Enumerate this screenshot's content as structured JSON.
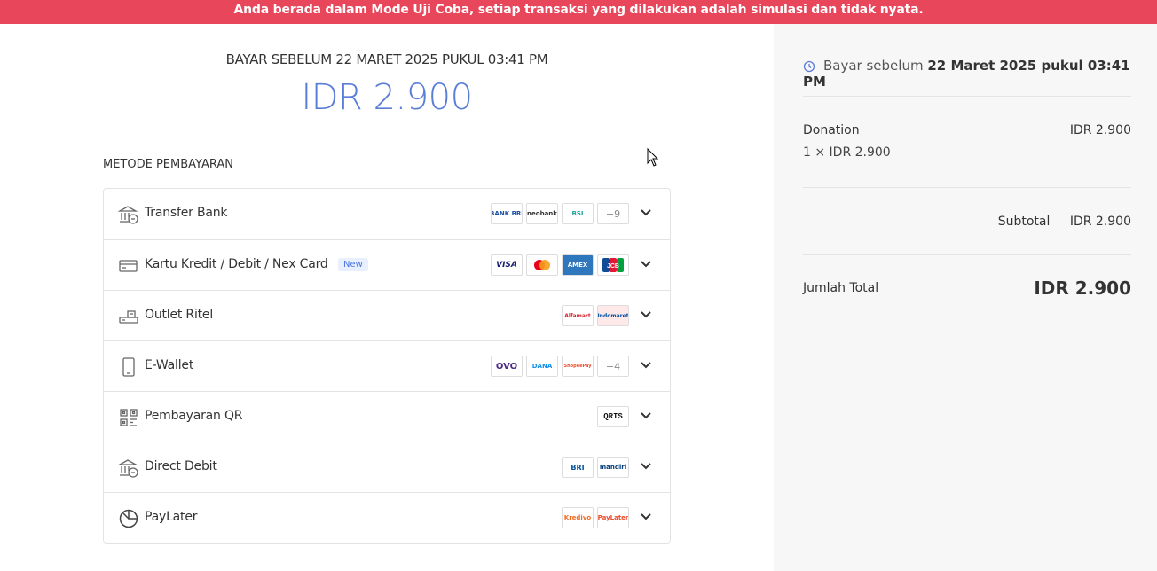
{
  "banner": {
    "text": "Anda berada dalam Mode Uji Coba, setiap transaksi yang dilakukan adalah simulasi dan tidak nyata."
  },
  "payment": {
    "due_heading": "BAYAR SEBELUM 22 MARET 2025 PUKUL 03:41 PM",
    "amount": "IDR 2.900"
  },
  "methods": {
    "section_label": "METODE PEMBAYARAN",
    "items": [
      {
        "label": "Transfer Bank",
        "icon": "bank-icon",
        "logos": [
          "BANK BRI",
          "neobank",
          "BSI",
          "+9"
        ]
      },
      {
        "label": "Kartu Kredit / Debit / Nex Card",
        "badge": "New",
        "icon": "credit-card-icon",
        "logos": [
          "VISA",
          "mastercard",
          "AMEX",
          "JCB"
        ]
      },
      {
        "label": "Outlet Ritel",
        "icon": "retail-register-icon",
        "logos": [
          "Alfamart",
          "Indomaret"
        ]
      },
      {
        "label": "E-Wallet",
        "icon": "phone-icon",
        "logos": [
          "OVO",
          "DANA",
          "ShopeePay",
          "+4"
        ]
      },
      {
        "label": "Pembayaran QR",
        "icon": "qr-code-icon",
        "logos": [
          "QRIS"
        ]
      },
      {
        "label": "Direct Debit",
        "icon": "bank-icon",
        "logos": [
          "BRI",
          "mandiri"
        ]
      },
      {
        "label": "PayLater",
        "icon": "pie-chart-icon",
        "logos": [
          "Kredivo",
          "PayLater"
        ]
      }
    ]
  },
  "summary": {
    "due_label": "Bayar sebelum",
    "due_value": "22 Maret 2025 pukul 03:41 PM",
    "item_name": "Donation",
    "item_price": "IDR 2.900",
    "item_qty": "1 × IDR 2.900",
    "subtotal_label": "Subtotal",
    "subtotal_value": "IDR 2.900",
    "total_label": "Jumlah Total",
    "total_value": "IDR 2.900"
  },
  "colors": {
    "banner": "#e8475b",
    "amount": "#5a7ed8",
    "sidebar_bg": "#f7f7f7"
  }
}
